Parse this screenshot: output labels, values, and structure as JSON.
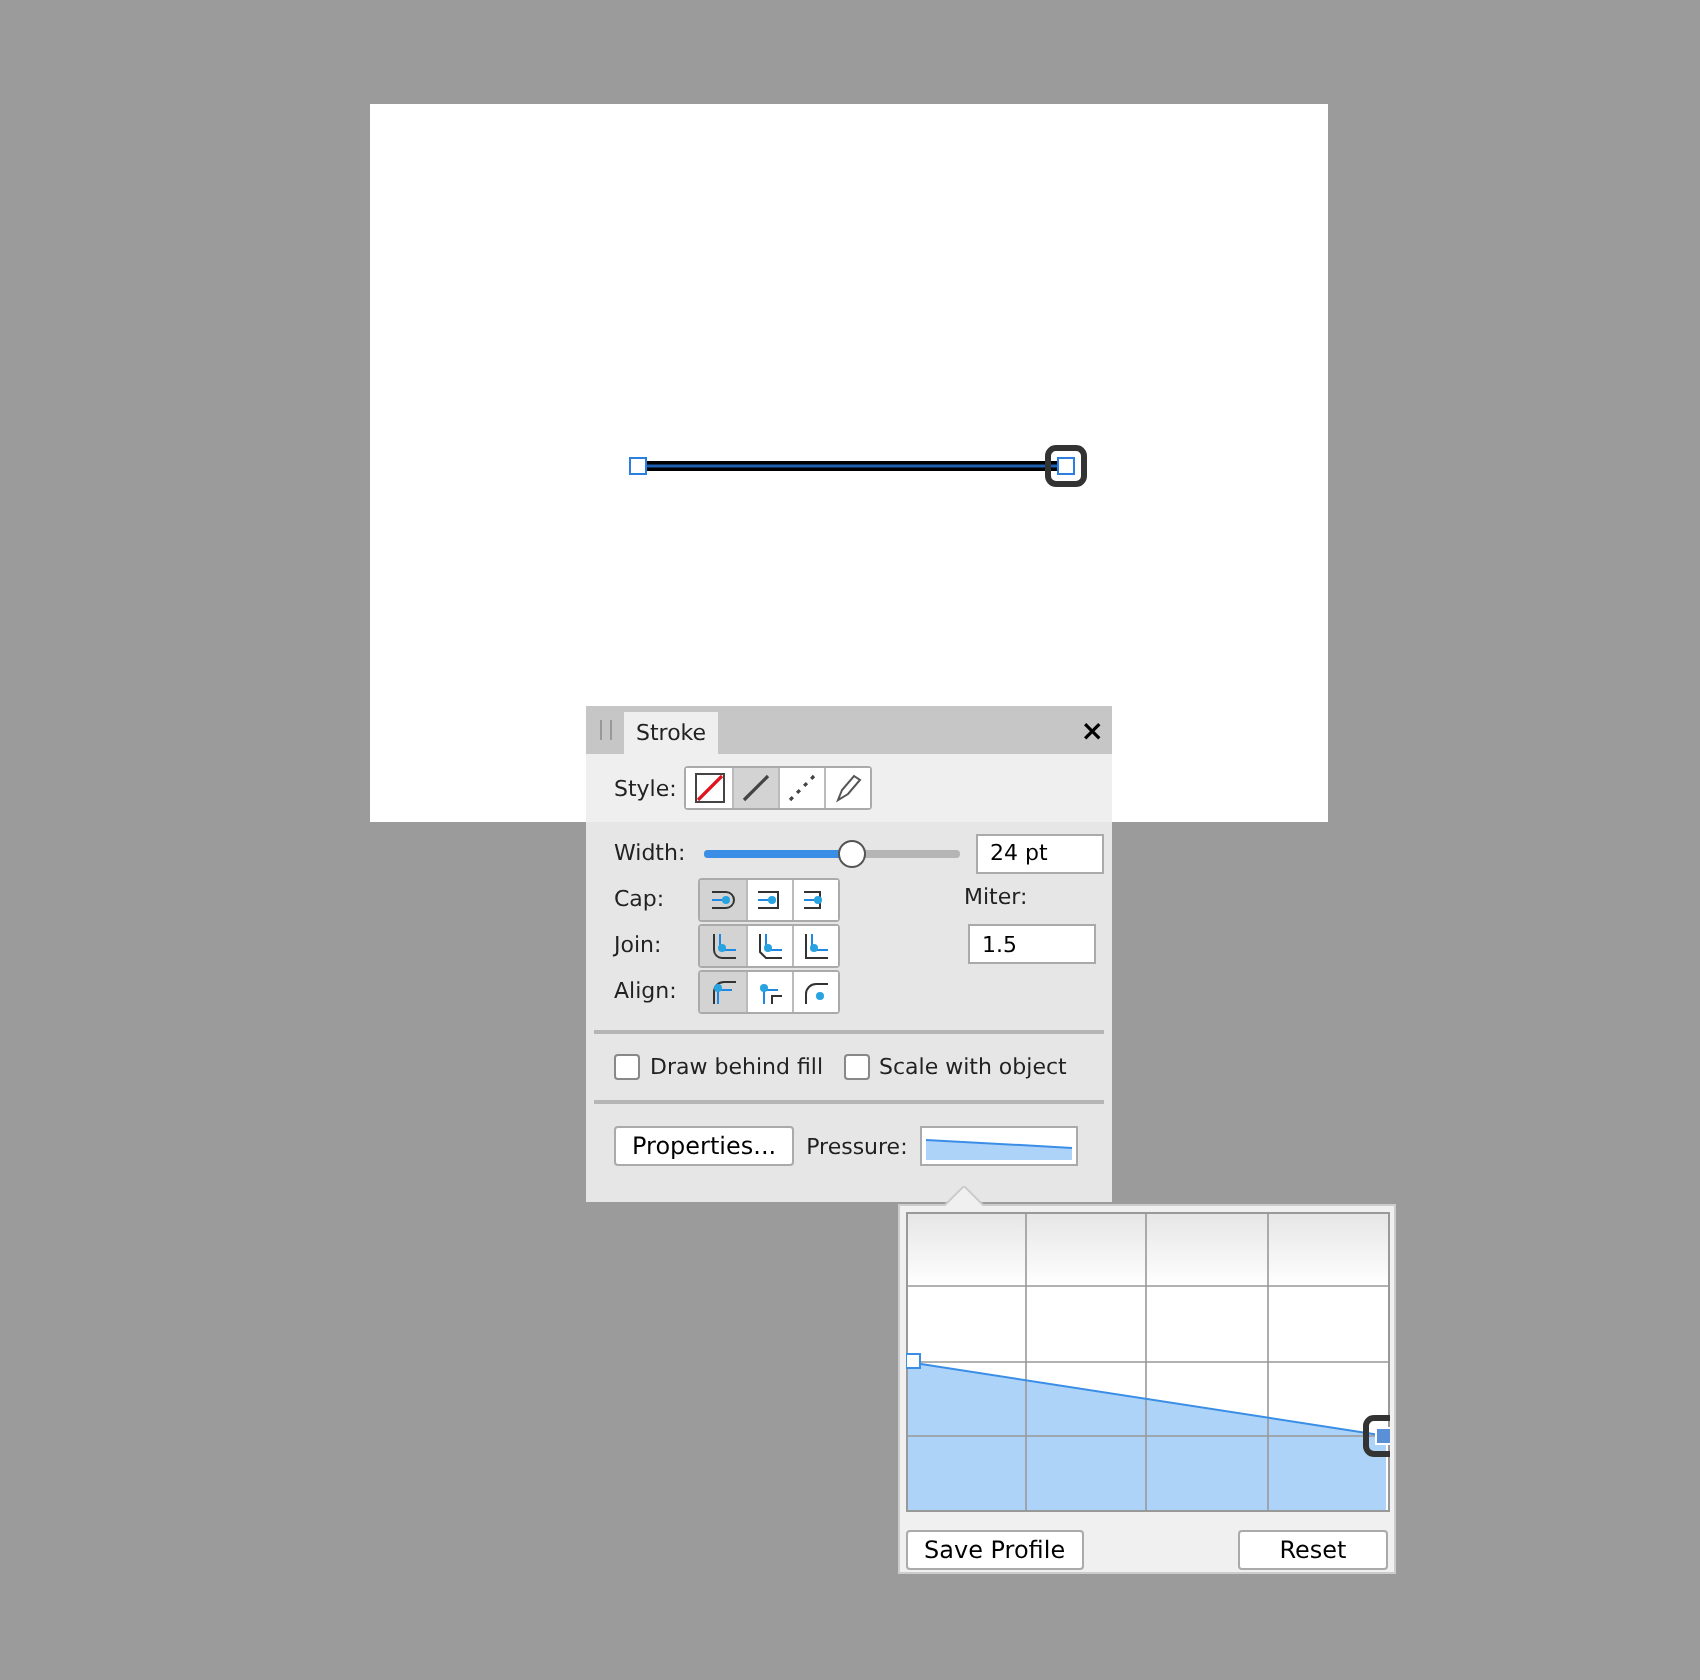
{
  "panel": {
    "tab": {
      "label": "Stroke",
      "selected": true
    },
    "close": "×",
    "style": {
      "label": "Style:",
      "options": [
        {
          "kind": "none",
          "selected": false
        },
        {
          "kind": "solid",
          "selected": true
        },
        {
          "kind": "dashed",
          "selected": false
        },
        {
          "kind": "brush",
          "selected": false
        }
      ]
    },
    "width": {
      "label": "Width:",
      "level": 0.58,
      "value": "24 pt"
    },
    "cap": {
      "label": "Cap:",
      "options": [
        {
          "selected": true
        },
        {
          "selected": false
        },
        {
          "selected": false
        }
      ]
    },
    "join": {
      "label": "Join:",
      "options": [
        {
          "selected": true
        },
        {
          "selected": false
        },
        {
          "selected": false
        }
      ]
    },
    "align": {
      "label": "Align:",
      "options": [
        {
          "selected": true
        },
        {
          "selected": false
        },
        {
          "selected": false
        }
      ]
    },
    "miter": {
      "label": "Miter:",
      "value": "1.5"
    },
    "checkboxes": [
      {
        "label": "Draw behind fill",
        "checked": false
      },
      {
        "label": "Scale with object",
        "checked": false
      }
    ],
    "properties_button": "Properties...",
    "pressure_label": "Pressure:"
  },
  "pressure_popup": {
    "buttons": [
      "Save Profile",
      "Reset"
    ]
  }
}
